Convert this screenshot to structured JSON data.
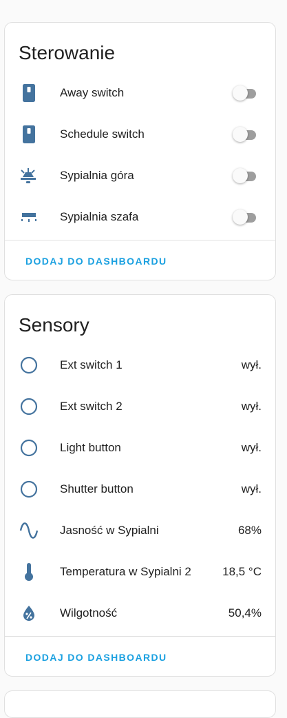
{
  "colors": {
    "icon": "#44739e",
    "accent": "#03a9f4",
    "toggle_track_off": "#9e9e9e"
  },
  "sterowanie": {
    "title": "Sterowanie",
    "items": [
      {
        "label": "Away switch",
        "icon": "light-switch-icon",
        "state": "off"
      },
      {
        "label": "Schedule switch",
        "icon": "light-switch-icon",
        "state": "off"
      },
      {
        "label": "Sypialnia góra",
        "icon": "ceiling-light-icon",
        "state": "off"
      },
      {
        "label": "Sypialnia szafa",
        "icon": "wall-light-icon",
        "state": "off"
      }
    ],
    "footer_button": "DODAJ DO DASHBOARDU"
  },
  "sensory": {
    "title": "Sensory",
    "items": [
      {
        "label": "Ext switch 1",
        "value": "wył.",
        "icon": "circle-outline-icon"
      },
      {
        "label": "Ext switch 2",
        "value": "wył.",
        "icon": "circle-outline-icon"
      },
      {
        "label": "Light button",
        "value": "wył.",
        "icon": "circle-outline-icon"
      },
      {
        "label": "Shutter button",
        "value": "wył.",
        "icon": "circle-outline-icon"
      },
      {
        "label": "Jasność w Sypialni",
        "value": "68%",
        "icon": "sine-wave-icon"
      },
      {
        "label": "Temperatura w Sypialni 2",
        "value": "18,5 °C",
        "icon": "thermometer-icon"
      },
      {
        "label": "Wilgotność",
        "value": "50,4%",
        "icon": "water-percent-icon"
      }
    ],
    "footer_button": "DODAJ DO DASHBOARDU"
  }
}
